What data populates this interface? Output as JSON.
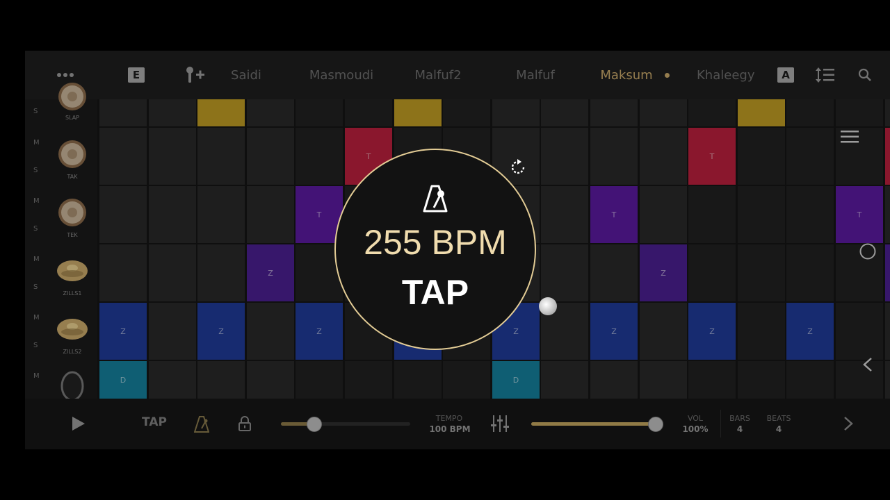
{
  "topbar": {
    "edit_label": "E",
    "auto_label": "A",
    "tabs": [
      {
        "label": "Saidi",
        "active": false
      },
      {
        "label": "Masmoudi",
        "active": false
      },
      {
        "label": "Malfuf2",
        "active": false
      },
      {
        "label": "Malfuf",
        "active": false
      },
      {
        "label": "Maksum",
        "active": true
      },
      {
        "label": "Khaleegy",
        "active": false
      }
    ]
  },
  "tracks": [
    {
      "name": "SLAP",
      "mute": "",
      "solo": "S",
      "letter": "",
      "color": "#bc9a23",
      "icon": "slap-drum-icon",
      "steps": [
        0,
        0,
        1,
        0,
        0,
        0,
        1,
        0,
        0,
        0,
        0,
        0,
        0,
        1,
        0,
        0,
        0
      ]
    },
    {
      "name": "TAK",
      "mute": "M",
      "solo": "S",
      "letter": "T",
      "color": "#b81f3c",
      "icon": "tak-drum-icon",
      "steps": [
        0,
        0,
        0,
        0,
        0,
        1,
        0,
        0,
        0,
        0,
        0,
        0,
        1,
        0,
        0,
        0,
        1
      ]
    },
    {
      "name": "TEK",
      "mute": "M",
      "solo": "S",
      "letter": "T",
      "color": "#5a1a9e",
      "icon": "tek-drum-icon",
      "steps": [
        0,
        0,
        0,
        0,
        1,
        0,
        0,
        0,
        0,
        0,
        1,
        0,
        0,
        0,
        0,
        1,
        0
      ]
    },
    {
      "name": "ZILLS1",
      "mute": "M",
      "solo": "S",
      "letter": "Z",
      "color": "#4a1f8f",
      "icon": "zills1-cymbal-icon",
      "steps": [
        0,
        0,
        0,
        1,
        0,
        0,
        0,
        0,
        0,
        0,
        0,
        1,
        0,
        0,
        0,
        0,
        1
      ]
    },
    {
      "name": "ZILLS2",
      "mute": "M",
      "solo": "S",
      "letter": "Z",
      "color": "#1f3a96",
      "icon": "zills2-cymbal-icon",
      "steps": [
        1,
        0,
        1,
        0,
        1,
        0,
        1,
        0,
        1,
        0,
        1,
        0,
        1,
        0,
        1,
        0,
        0
      ]
    },
    {
      "name": "",
      "mute": "M",
      "solo": "",
      "letter": "D",
      "color": "#157e9a",
      "icon": "tambourine-icon",
      "steps": [
        1,
        0,
        0,
        0,
        0,
        0,
        0,
        0,
        1,
        0,
        0,
        0,
        0,
        0,
        0,
        0,
        0
      ]
    }
  ],
  "bottombar": {
    "tap_label": "TAP",
    "tempo_label": "TEMPO",
    "tempo_value": "100 BPM",
    "tempo_fraction": 0.25,
    "vol_label": "VOL",
    "vol_value": "100%",
    "vol_fraction": 1.0,
    "bars_label": "BARS",
    "bars_value": "4",
    "beats_label": "BEATS",
    "beats_value": "4"
  },
  "overlay": {
    "bpm_text": "255 BPM",
    "tap_text": "TAP"
  },
  "colors": {
    "accent_gold": "#e3cc95",
    "active_tab": "#c9a86a"
  }
}
